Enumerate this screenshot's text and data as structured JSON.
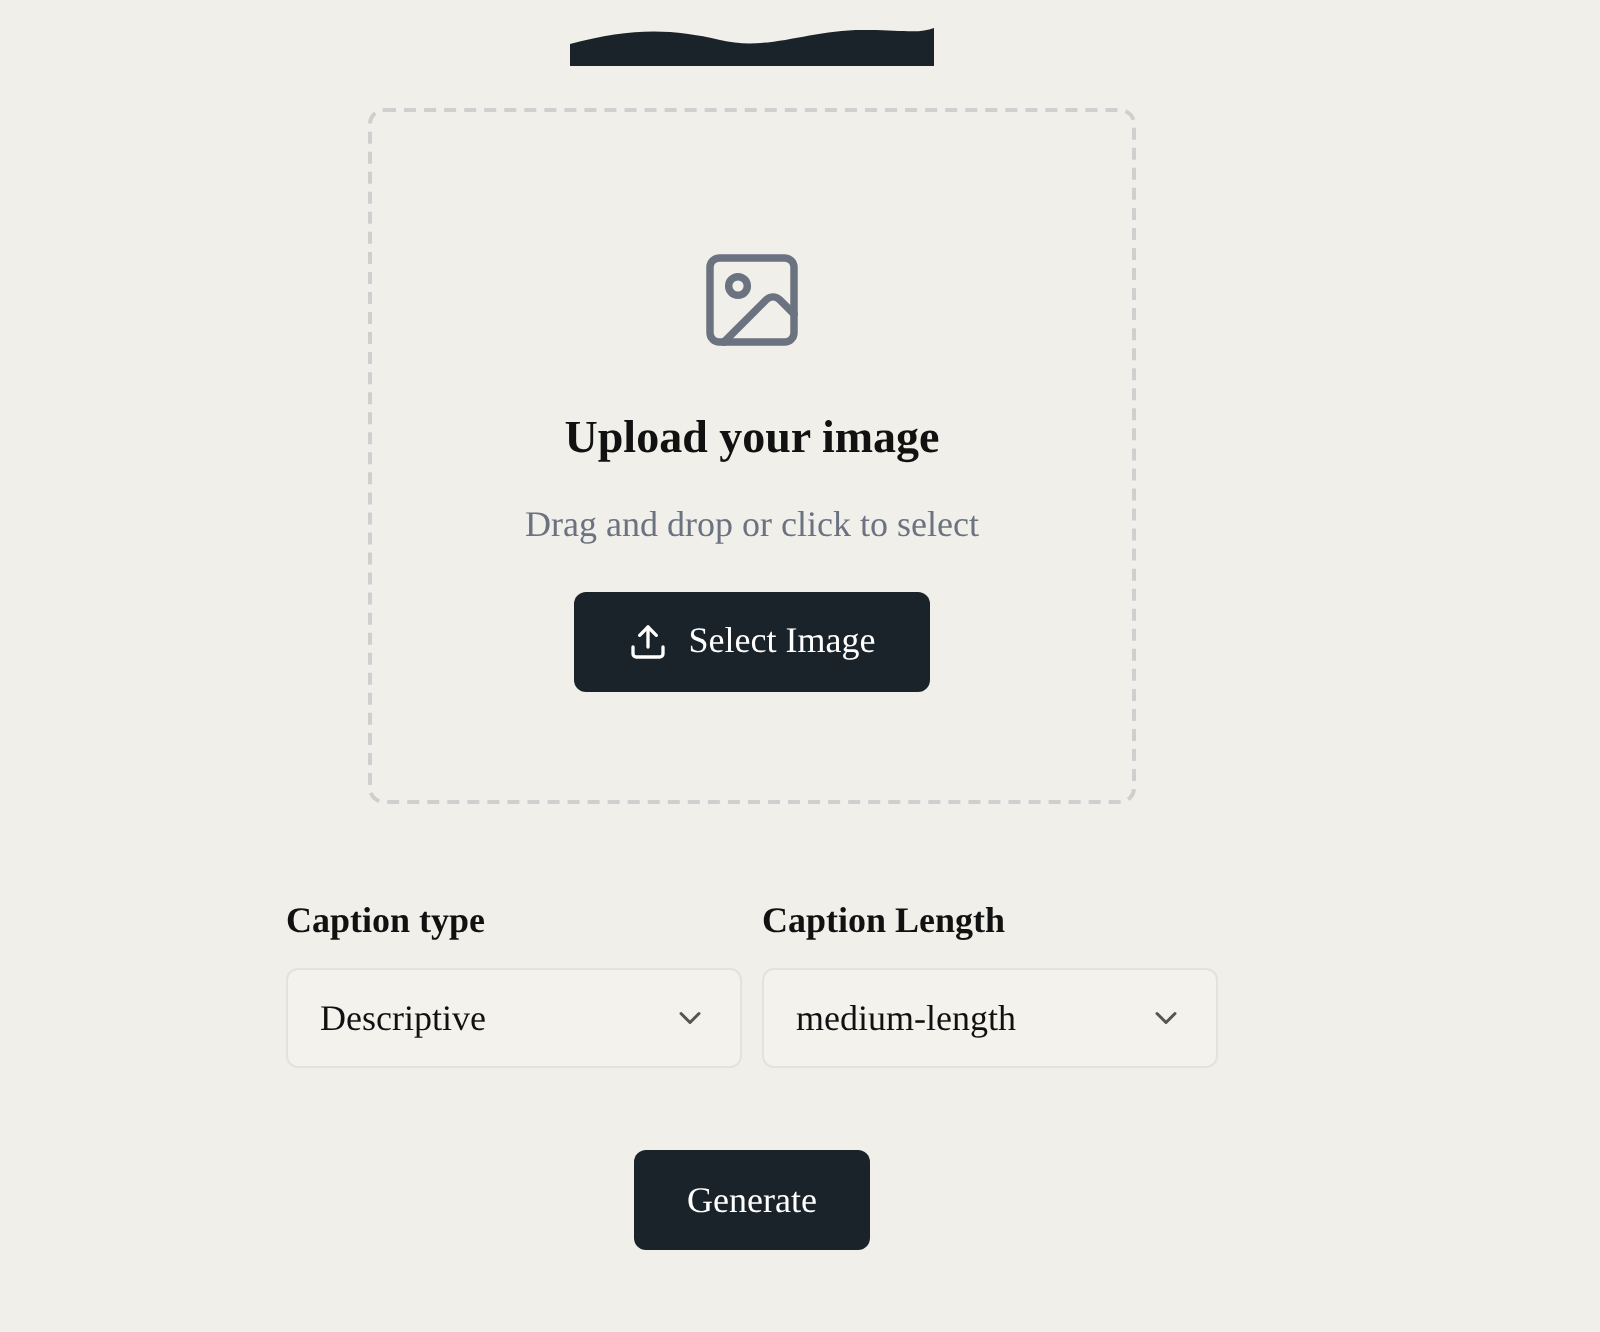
{
  "upload": {
    "title": "Upload your image",
    "subtitle": "Drag and drop or click to select",
    "button": "Select Image"
  },
  "fields": [
    {
      "label": "Caption type",
      "value": "Descriptive"
    },
    {
      "label": "Caption Length",
      "value": "medium-length"
    }
  ],
  "generate_button": "Generate"
}
